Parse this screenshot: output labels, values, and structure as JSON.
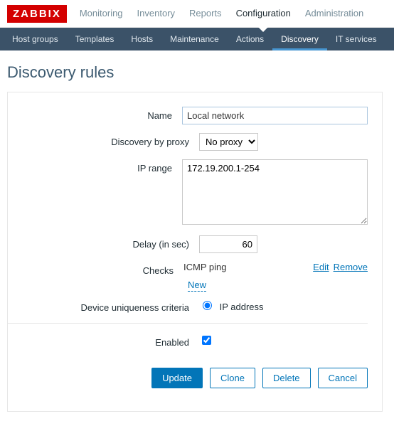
{
  "logo": "ZABBIX",
  "topnav": {
    "items": [
      "Monitoring",
      "Inventory",
      "Reports",
      "Configuration",
      "Administration"
    ],
    "active": 3
  },
  "subnav": {
    "items": [
      "Host groups",
      "Templates",
      "Hosts",
      "Maintenance",
      "Actions",
      "Discovery",
      "IT services"
    ],
    "active": 5
  },
  "page": {
    "title": "Discovery rules"
  },
  "form": {
    "labels": {
      "name": "Name",
      "proxy": "Discovery by proxy",
      "iprange": "IP range",
      "delay": "Delay (in sec)",
      "checks": "Checks",
      "unique": "Device uniqueness criteria",
      "enabled": "Enabled"
    },
    "values": {
      "name": "Local network",
      "proxy_selected": "No proxy",
      "iprange": "172.19.200.1-254",
      "delay": "60",
      "unique_option": "IP address",
      "enabled": true
    },
    "checks": {
      "items": [
        {
          "name": "ICMP ping",
          "edit": "Edit",
          "remove": "Remove"
        }
      ],
      "new": "New"
    },
    "buttons": {
      "update": "Update",
      "clone": "Clone",
      "delete": "Delete",
      "cancel": "Cancel"
    }
  }
}
